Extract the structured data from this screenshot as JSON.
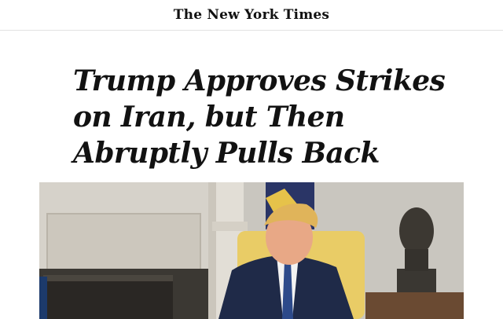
{
  "masthead": {
    "logo_text": "The New York Times"
  },
  "article": {
    "headline_lines": [
      "Trump Approves Strikes",
      "on Iran, but Then",
      "Abruptly Pulls Back"
    ]
  },
  "photo": {
    "subject": "press-photo"
  },
  "colors": {
    "text": "#121212",
    "divider": "#e2e2e2",
    "background": "#ffffff"
  }
}
